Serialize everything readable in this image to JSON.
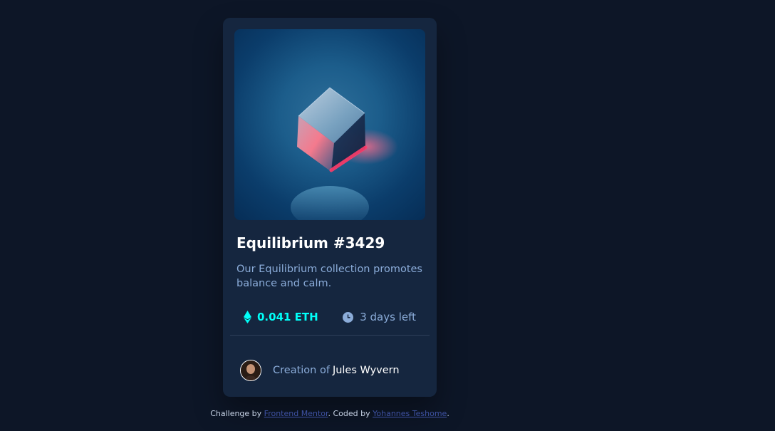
{
  "card": {
    "image_alt": "equilibrium-image",
    "title": "Equilibrium #3429",
    "description": "Our Equilibrium collection promotes balance and calm.",
    "price": "0.041 ETH",
    "time_left": "3 days left",
    "creator_prefix": "Creation of",
    "creator_name": "Jules Wyvern"
  },
  "attribution": {
    "prefix": "Challenge by",
    "challenge_link": "Frontend Mentor",
    "middle": ". Coded by",
    "author_link": "Yohannes Teshome",
    "suffix": "."
  },
  "colors": {
    "page_bg": "#0d1627",
    "card_bg": "#15263f",
    "cyan": "#00fff8",
    "soft_blue": "#8bacd9",
    "white": "#ffffff",
    "divider": "#2e405a",
    "link": "#3e52a3"
  },
  "icons": {
    "price": "ethereum-icon",
    "time": "clock-icon"
  }
}
